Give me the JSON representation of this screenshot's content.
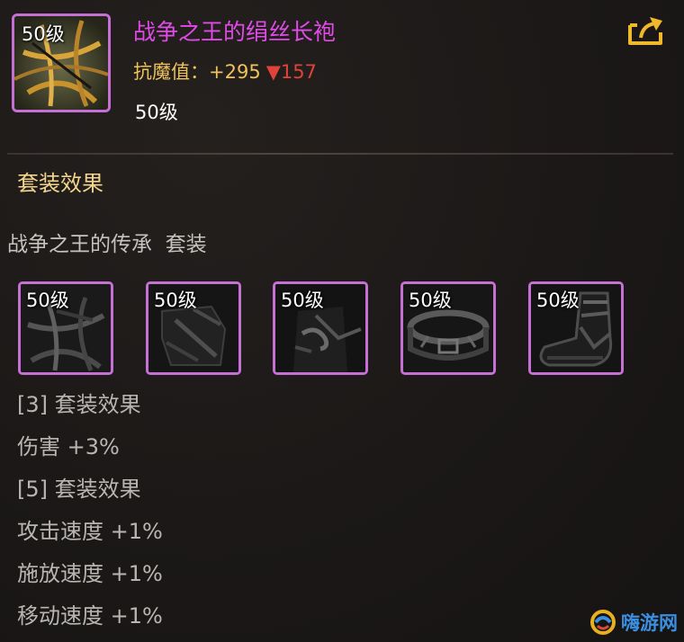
{
  "item": {
    "level_badge": "50级",
    "name": "战争之王的绢丝长袍",
    "stat_label": "抗魔值：",
    "stat_increase": "+295",
    "stat_decrease": "▼157",
    "level_text": "50级"
  },
  "set_section": {
    "title": "套装效果",
    "set_name": "战争之王的传承  套装",
    "pieces": [
      {
        "level": "50级",
        "icon": "robe-icon"
      },
      {
        "level": "50级",
        "icon": "shoulder-icon"
      },
      {
        "level": "50级",
        "icon": "pants-icon"
      },
      {
        "level": "50级",
        "icon": "belt-icon"
      },
      {
        "level": "50级",
        "icon": "shoes-icon"
      }
    ],
    "effects": [
      "[3] 套装效果",
      "伤害 +3%",
      "[5] 套装效果",
      "攻击速度 +1%",
      "施放速度 +1%",
      "移动速度 +1%"
    ]
  },
  "watermark": {
    "text": "嗨游网"
  },
  "colors": {
    "item_name": "#e04be8",
    "stat_gold": "#efc35a",
    "stat_down_red": "#e0433a",
    "rarity_border": "#c66fd4",
    "section_title": "#f3d58c"
  }
}
